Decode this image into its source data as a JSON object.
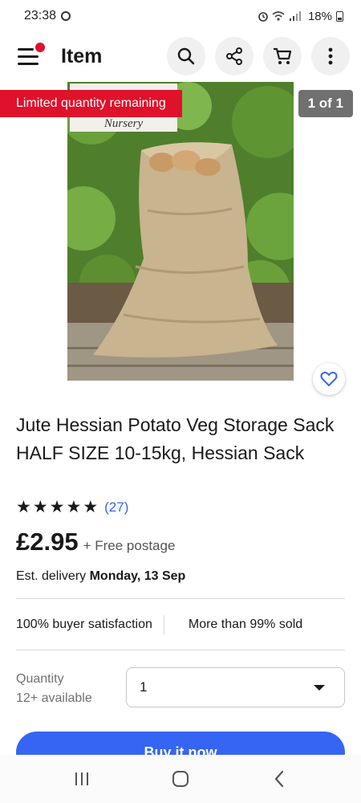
{
  "status_bar": {
    "time": "23:38",
    "battery": "18%"
  },
  "app_bar": {
    "title": "Item",
    "icons": [
      "menu-icon",
      "search-icon",
      "share-icon",
      "cart-icon",
      "more-icon"
    ]
  },
  "gallery": {
    "badge_limited": "Limited quantity remaining",
    "image_counter": "1 of 1",
    "image_description": "jute hessian sack of potatoes",
    "accent_red": "#e0112b"
  },
  "item": {
    "title": "Jute Hessian Potato Veg Storage Sack HALF SIZE 10-15kg, Hessian Sack",
    "rating_stars": 5,
    "rating_count": "(27)",
    "price": "£2.95",
    "postage": "+ Free postage",
    "delivery_prefix": "Est. delivery",
    "delivery_date": "Monday, 13 Sep"
  },
  "stats": {
    "satisfaction": "100% buyer satisfaction",
    "sold": "More than 99% sold"
  },
  "quantity": {
    "label": "Quantity",
    "available": "12+ available",
    "selected": "1"
  },
  "buy": {
    "label": "Buy it now",
    "color": "#3665f3"
  }
}
